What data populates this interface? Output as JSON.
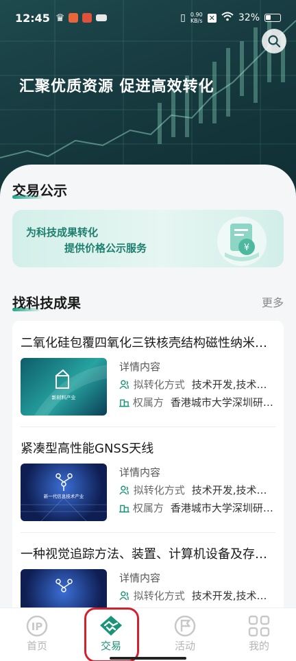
{
  "status_bar": {
    "time": "12:45",
    "speed_top": "0.90",
    "speed_bottom": "KB/s",
    "battery": "32%"
  },
  "hero": {
    "title": "汇聚优质资源 促进高效转化",
    "search_icon": "search-icon"
  },
  "trade_notice": {
    "title": "交易公示",
    "banner_line1": "为科技成果转化",
    "banner_line2": "提供价格公示服务",
    "banner_icon": "price-document-icon"
  },
  "achievements": {
    "title": "找科技成果",
    "more": "更多",
    "detail_label": "详情内容",
    "transfer_label": "拟转化方式",
    "owner_label": "权属方",
    "items": [
      {
        "title": "二氧化硅包覆四氧化三铁核壳结构磁性纳米颗粒",
        "thumb_caption": "新材料产业",
        "transfer_value": "技术开发,技术转让",
        "owner_value": "香港城市大学深圳研究院"
      },
      {
        "title": "紧凑型高性能GNSS天线",
        "thumb_caption": "新一代信息技术产业",
        "transfer_value": "技术开发,技术转让",
        "owner_value": "香港城市大学深圳研究院"
      },
      {
        "title": "一种视觉追踪方法、装置、计算机设备及存储介质",
        "thumb_caption": "新一代信息技术产业",
        "transfer_value": "技术开发,技术转让",
        "owner_value": ""
      }
    ]
  },
  "tab_bar": {
    "tabs": [
      {
        "label": "首页",
        "icon": "ip-home-icon"
      },
      {
        "label": "交易",
        "icon": "handshake-icon"
      },
      {
        "label": "活动",
        "icon": "flag-icon"
      },
      {
        "label": "我的",
        "icon": "grid-profile-icon"
      }
    ],
    "active": "交易"
  },
  "colors": {
    "accent": "#1a9479",
    "hero_bg": "#173b40",
    "highlight": "#d4202c"
  }
}
